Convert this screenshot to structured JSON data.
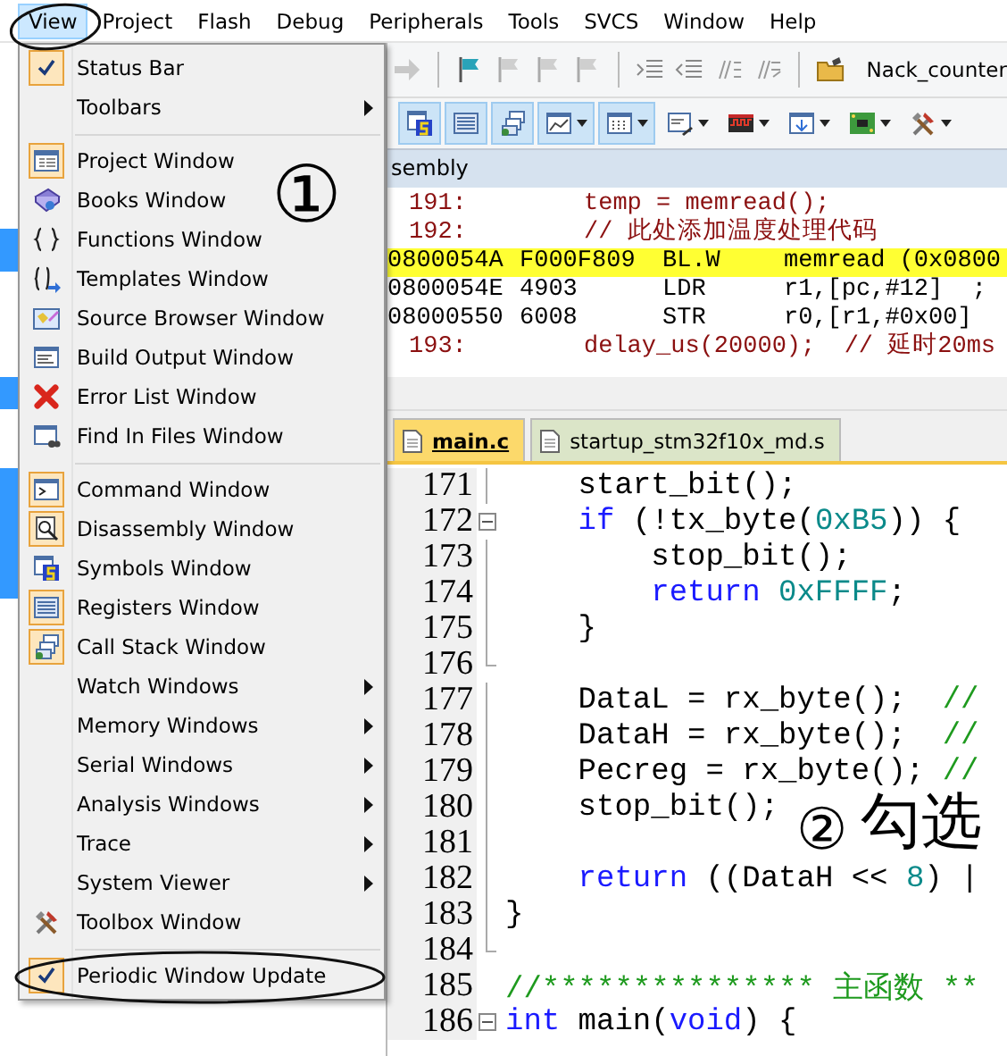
{
  "menu_bar": [
    {
      "label": "View",
      "selected": true
    },
    {
      "label": "Project",
      "selected": false
    },
    {
      "label": "Flash",
      "selected": false
    },
    {
      "label": "Debug",
      "selected": false
    },
    {
      "label": "Peripherals",
      "selected": false
    },
    {
      "label": "Tools",
      "selected": false
    },
    {
      "label": "SVCS",
      "selected": false
    },
    {
      "label": "Window",
      "selected": false
    },
    {
      "label": "Help",
      "selected": false
    }
  ],
  "view_menu": [
    {
      "kind": "item",
      "label": "Status Bar",
      "checked": true,
      "submenu": false
    },
    {
      "kind": "item",
      "label": "Toolbars",
      "checked": false,
      "submenu": true
    },
    {
      "kind": "separator"
    },
    {
      "kind": "item",
      "label": "Project Window",
      "checked": true,
      "submenu": false
    },
    {
      "kind": "item",
      "label": "Books Window",
      "checked": false,
      "submenu": false
    },
    {
      "kind": "item",
      "label": "Functions Window",
      "checked": false,
      "submenu": false
    },
    {
      "kind": "item",
      "label": "Templates Window",
      "checked": false,
      "submenu": false
    },
    {
      "kind": "item",
      "label": "Source Browser Window",
      "checked": false,
      "submenu": false
    },
    {
      "kind": "item",
      "label": "Build Output Window",
      "checked": false,
      "submenu": false
    },
    {
      "kind": "item",
      "label": "Error List Window",
      "checked": false,
      "submenu": false
    },
    {
      "kind": "item",
      "label": "Find In Files Window",
      "checked": false,
      "submenu": false
    },
    {
      "kind": "separator"
    },
    {
      "kind": "item",
      "label": "Command Window",
      "checked": true,
      "submenu": false
    },
    {
      "kind": "item",
      "label": "Disassembly Window",
      "checked": true,
      "submenu": false
    },
    {
      "kind": "item",
      "label": "Symbols Window",
      "checked": false,
      "submenu": false
    },
    {
      "kind": "item",
      "label": "Registers Window",
      "checked": true,
      "submenu": false
    },
    {
      "kind": "item",
      "label": "Call Stack Window",
      "checked": true,
      "submenu": false
    },
    {
      "kind": "item",
      "label": "Watch Windows",
      "checked": false,
      "submenu": true
    },
    {
      "kind": "item",
      "label": "Memory Windows",
      "checked": false,
      "submenu": true
    },
    {
      "kind": "item",
      "label": "Serial Windows",
      "checked": false,
      "submenu": true
    },
    {
      "kind": "item",
      "label": "Analysis Windows",
      "checked": false,
      "submenu": true
    },
    {
      "kind": "item",
      "label": "Trace",
      "checked": false,
      "submenu": true
    },
    {
      "kind": "item",
      "label": "System Viewer",
      "checked": false,
      "submenu": true
    },
    {
      "kind": "item",
      "label": "Toolbox Window",
      "checked": false,
      "submenu": false
    },
    {
      "kind": "separator"
    },
    {
      "kind": "item",
      "label": "Periodic Window Update",
      "checked": true,
      "submenu": false
    }
  ],
  "toolbar": {
    "target": "Nack_counter"
  },
  "debug_toolbar": [
    {
      "pressed": true,
      "dropdown": false
    },
    {
      "pressed": true,
      "dropdown": false
    },
    {
      "pressed": true,
      "dropdown": false
    },
    {
      "pressed": true,
      "dropdown": true
    },
    {
      "pressed": true,
      "dropdown": true
    },
    {
      "pressed": false,
      "dropdown": true
    },
    {
      "pressed": false,
      "dropdown": true
    },
    {
      "pressed": false,
      "dropdown": true
    },
    {
      "pressed": false,
      "dropdown": true
    },
    {
      "pressed": false,
      "dropdown": true
    }
  ],
  "disassembly": {
    "title": "sembly",
    "rows": [
      {
        "kind": "source",
        "line": "191:",
        "code": "temp = memread();",
        "highlighted": false
      },
      {
        "kind": "source",
        "line": "192:",
        "code": "// 此处添加温度处理代码",
        "highlighted": false
      },
      {
        "kind": "asm",
        "address": "0800054A",
        "opcode": "F000F809",
        "mnemonic": "BL.W",
        "operands": "memread (0x0800",
        "highlighted": true
      },
      {
        "kind": "asm",
        "address": "0800054E",
        "opcode": "4903",
        "mnemonic": "LDR",
        "operands": "r1,[pc,#12]  ;",
        "highlighted": false
      },
      {
        "kind": "asm",
        "address": "08000550",
        "opcode": "6008",
        "mnemonic": "STR",
        "operands": "r0,[r1,#0x00]",
        "highlighted": false
      },
      {
        "kind": "source",
        "line": "193:",
        "code": "delay_us(20000);  // 延时20ms",
        "highlighted": false
      }
    ]
  },
  "editor": {
    "tabs": [
      {
        "label": "main.c",
        "selected": true
      },
      {
        "label": "startup_stm32f10x_md.s",
        "selected": false
      }
    ],
    "lines": [
      {
        "number": "171",
        "fold_start": false,
        "fold_end": false,
        "segments": [
          {
            "kind": "plain",
            "text": "    start_bit();"
          }
        ]
      },
      {
        "number": "172",
        "fold_start": true,
        "fold_end": false,
        "segments": [
          {
            "kind": "keyword",
            "text": "    if"
          },
          {
            "kind": "plain",
            "text": " (!tx_byte("
          },
          {
            "kind": "number",
            "text": "0xB5"
          },
          {
            "kind": "plain",
            "text": ")) {"
          }
        ]
      },
      {
        "number": "173",
        "fold_start": false,
        "fold_end": false,
        "segments": [
          {
            "kind": "plain",
            "text": "        stop_bit();"
          }
        ]
      },
      {
        "number": "174",
        "fold_start": false,
        "fold_end": false,
        "segments": [
          {
            "kind": "keyword",
            "text": "        return"
          },
          {
            "kind": "number",
            "text": " 0xFFFF"
          },
          {
            "kind": "plain",
            "text": ";"
          }
        ]
      },
      {
        "number": "175",
        "fold_start": false,
        "fold_end": false,
        "segments": [
          {
            "kind": "plain",
            "text": "    }"
          }
        ]
      },
      {
        "number": "176",
        "fold_start": false,
        "fold_end": true
      },
      {
        "number": "177",
        "fold_start": false,
        "fold_end": false,
        "segments": [
          {
            "kind": "plain",
            "text": "    DataL = rx_byte();  "
          },
          {
            "kind": "comment",
            "text": "//"
          }
        ]
      },
      {
        "number": "178",
        "fold_start": false,
        "fold_end": false,
        "segments": [
          {
            "kind": "plain",
            "text": "    DataH = rx_byte();  "
          },
          {
            "kind": "comment",
            "text": "//"
          }
        ]
      },
      {
        "number": "179",
        "fold_start": false,
        "fold_end": false,
        "segments": [
          {
            "kind": "plain",
            "text": "    Pecreg = rx_byte(); "
          },
          {
            "kind": "comment",
            "text": "//"
          }
        ]
      },
      {
        "number": "180",
        "fold_start": false,
        "fold_end": false,
        "segments": [
          {
            "kind": "plain",
            "text": "    stop_bit();"
          }
        ]
      },
      {
        "number": "181",
        "fold_start": false,
        "fold_end": false
      },
      {
        "number": "182",
        "fold_start": false,
        "fold_end": false,
        "segments": [
          {
            "kind": "keyword",
            "text": "    return"
          },
          {
            "kind": "plain",
            "text": " ((DataH << "
          },
          {
            "kind": "number",
            "text": "8"
          },
          {
            "kind": "plain",
            "text": ") |"
          }
        ]
      },
      {
        "number": "183",
        "fold_start": false,
        "fold_end": false,
        "segments": [
          {
            "kind": "plain",
            "text": "}"
          }
        ]
      },
      {
        "number": "184",
        "fold_start": false,
        "fold_end": true
      },
      {
        "number": "185",
        "fold_start": false,
        "fold_end": false,
        "segments": [
          {
            "kind": "comment",
            "text": "//*************** 主函数 **"
          }
        ]
      },
      {
        "number": "186",
        "fold_start": true,
        "fold_end": false,
        "segments": [
          {
            "kind": "keyword",
            "text": "int"
          },
          {
            "kind": "plain",
            "text": " main("
          },
          {
            "kind": "keyword",
            "text": "void"
          },
          {
            "kind": "plain",
            "text": ") {"
          }
        ]
      }
    ]
  },
  "annotations": [
    {
      "kind": "step",
      "text": "①"
    },
    {
      "kind": "step",
      "text": "②"
    },
    {
      "kind": "label",
      "text": "勾选"
    }
  ]
}
